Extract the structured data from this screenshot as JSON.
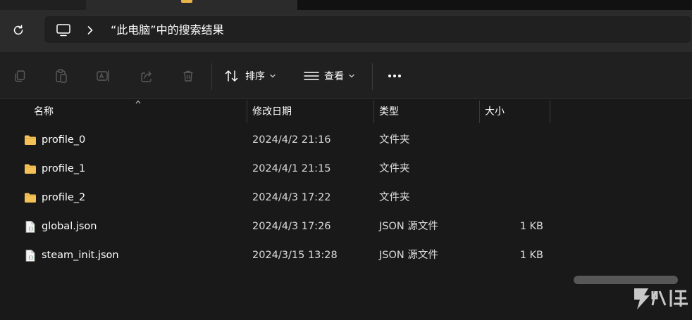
{
  "address": {
    "refresh_icon": "refresh-icon",
    "location_icon": "this-pc-icon",
    "path": "“此电脑”中的搜索结果"
  },
  "toolbar": {
    "icons": [
      "copy-icon",
      "paste-icon",
      "rename-icon",
      "share-icon",
      "delete-icon"
    ],
    "sort_label": "排序",
    "view_label": "查看",
    "more_icon": "more-icon"
  },
  "columns": {
    "name": "名称",
    "date": "修改日期",
    "type": "类型",
    "size": "大小"
  },
  "files": [
    {
      "name": "profile_0",
      "date": "2024/4/2 21:16",
      "type": "文件夹",
      "size": "",
      "icon": "folder-icon"
    },
    {
      "name": "profile_1",
      "date": "2024/4/1 21:15",
      "type": "文件夹",
      "size": "",
      "icon": "folder-icon"
    },
    {
      "name": "profile_2",
      "date": "2024/4/3 17:22",
      "type": "文件夹",
      "size": "",
      "icon": "folder-icon"
    },
    {
      "name": "global.json",
      "date": "2024/4/3 17:26",
      "type": "JSON 源文件",
      "size": "1 KB",
      "icon": "json-file-icon"
    },
    {
      "name": "steam_init.json",
      "date": "2024/3/15 13:28",
      "type": "JSON 源文件",
      "size": "1 KB",
      "icon": "json-file-icon"
    }
  ],
  "colors": {
    "background": "#191919",
    "toolbar": "#202020",
    "address_row": "#2b2b2b",
    "folder": "#f3c155",
    "text": "#ffffff"
  }
}
